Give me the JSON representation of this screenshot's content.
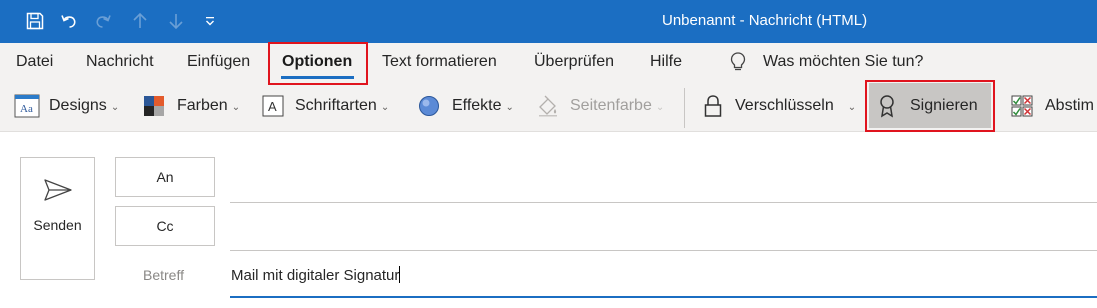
{
  "window": {
    "title": "Unbenannt  -  Nachricht (HTML)"
  },
  "quick_access": [
    {
      "name": "save-icon",
      "enabled": true
    },
    {
      "name": "undo-icon",
      "enabled": true
    },
    {
      "name": "redo-icon",
      "enabled": false
    },
    {
      "name": "arrow-up-icon",
      "enabled": false
    },
    {
      "name": "arrow-down-icon",
      "enabled": false
    },
    {
      "name": "customize-dropdown-icon",
      "enabled": true
    }
  ],
  "tabs": [
    {
      "label": "Datei",
      "active": false
    },
    {
      "label": "Nachricht",
      "active": false
    },
    {
      "label": "Einfügen",
      "active": false
    },
    {
      "label": "Optionen",
      "active": true,
      "highlighted": true
    },
    {
      "label": "Text formatieren",
      "active": false
    },
    {
      "label": "Überprüfen",
      "active": false
    },
    {
      "label": "Hilfe",
      "active": false
    }
  ],
  "tell_me": {
    "icon": "lightbulb-icon",
    "text": "Was möchten Sie tun?"
  },
  "ribbon": {
    "designs": "Designs",
    "farben": "Farben",
    "schriftarten": "Schriftarten",
    "effekte": "Effekte",
    "seitenfarbe": "Seitenfarbe",
    "seitenfarbe_enabled": false,
    "verschluesseln": "Verschlüsseln",
    "signieren": "Signieren",
    "signieren_highlighted": true,
    "abstimmung": "Abstim"
  },
  "compose": {
    "send_label": "Senden",
    "to_label": "An",
    "cc_label": "Cc",
    "subject_label": "Betreff",
    "to_value": "",
    "cc_value": "",
    "subject_value": "Mail mit digitaler Signatur"
  },
  "colors": {
    "title_bar": "#1b6ec2",
    "ribbon_bg": "#f3f2f1",
    "highlight_box": "#e0141e",
    "active_tab_underline": "#1b6ec2"
  }
}
